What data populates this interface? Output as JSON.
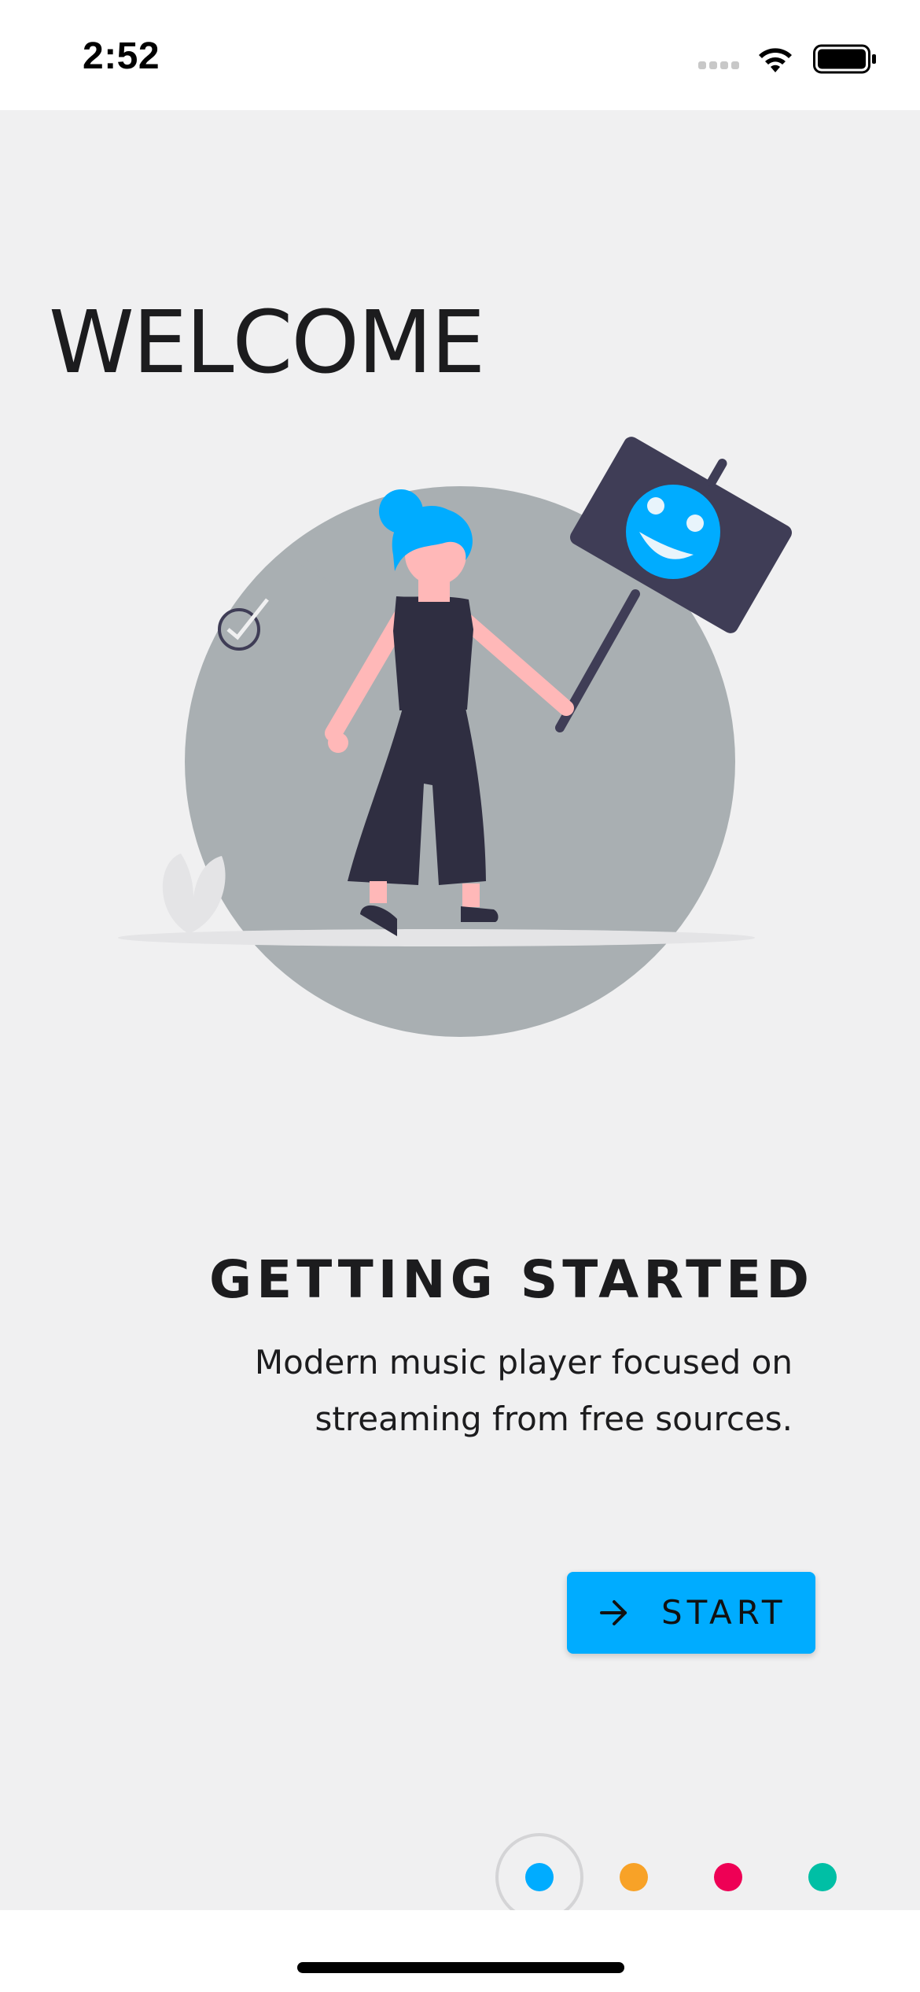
{
  "status_bar": {
    "time": "2:52"
  },
  "screen": {
    "title": "WELCOME",
    "heading": "GETTING STARTED",
    "description_line1": "Modern music player focused on",
    "description_line2": "streaming from free sources.",
    "start_button": {
      "label": "START",
      "icon": "arrow-right-icon",
      "color": "#00acff"
    },
    "pager": {
      "active_index": 0,
      "dots": [
        {
          "color": "#00acff"
        },
        {
          "color": "#f8a227"
        },
        {
          "color": "#ee0055"
        },
        {
          "color": "#00bfa5"
        }
      ]
    }
  },
  "colors": {
    "background": "#f0f0f1",
    "illustration_circle": "#a9afb2",
    "sign": "#3f3d56",
    "accent_blue": "#00acff"
  }
}
